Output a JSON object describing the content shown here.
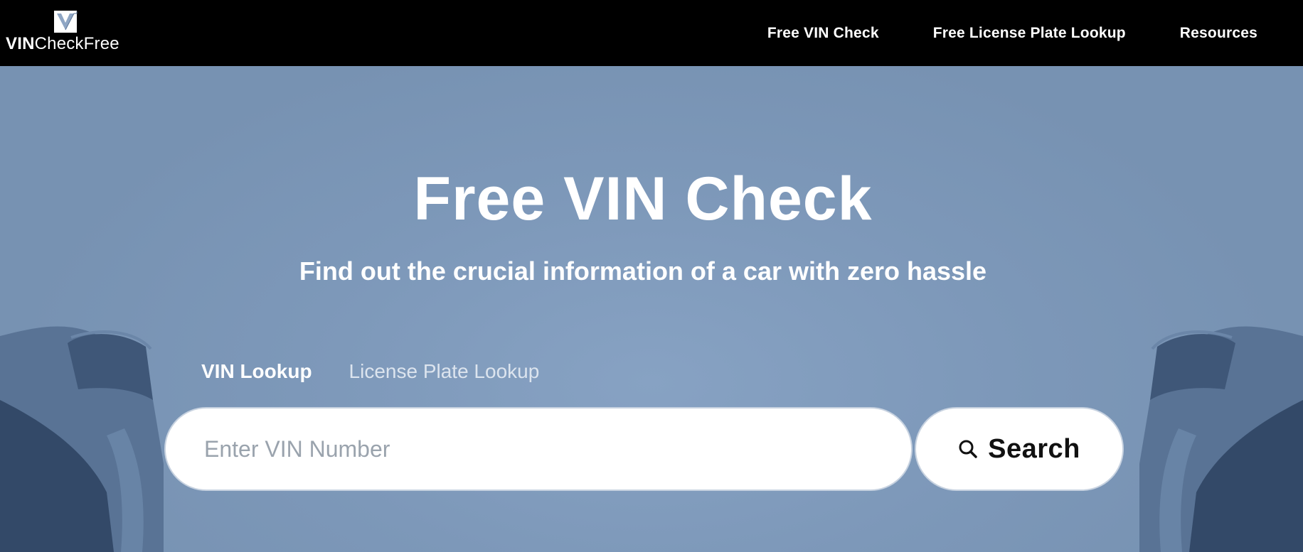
{
  "logo": {
    "text_bold": "VIN",
    "text_regular": "CheckFree"
  },
  "nav": {
    "items": [
      {
        "label": "Free VIN Check"
      },
      {
        "label": "Free License Plate Lookup"
      },
      {
        "label": "Resources"
      }
    ]
  },
  "hero": {
    "title": "Free VIN Check",
    "subtitle": "Find out the crucial information of a car with zero hassle",
    "tabs": [
      {
        "label": "VIN Lookup",
        "active": true
      },
      {
        "label": "License Plate Lookup",
        "active": false
      }
    ],
    "search": {
      "placeholder": "Enter VIN Number",
      "value": "",
      "button_label": "Search",
      "button_icon": "search-icon"
    }
  },
  "colors": {
    "header_bg": "#000000",
    "hero_bg": "#7f9abb",
    "text": "#ffffff"
  }
}
